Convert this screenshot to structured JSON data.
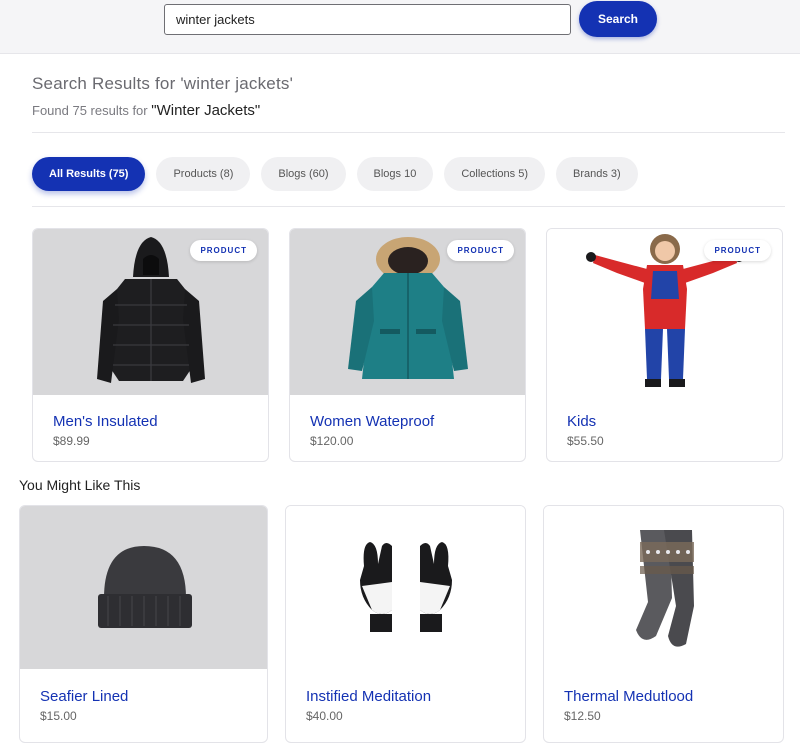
{
  "search": {
    "query": "winter jackets",
    "button_label": "Search"
  },
  "results": {
    "title": "Search Results for 'winter jackets'",
    "summary_prefix": "Found 75 results for",
    "summary_query": "\"Winter Jackets\""
  },
  "filters": [
    {
      "label": "All Results (75)",
      "active": true
    },
    {
      "label": "Products (8)",
      "active": false
    },
    {
      "label": "Blogs (60)",
      "active": false
    },
    {
      "label": "Blogs 10",
      "active": false
    },
    {
      "label": "Collections 5)",
      "active": false
    },
    {
      "label": "Brands 3)",
      "active": false
    }
  ],
  "products": [
    {
      "badge": "PRODUCT",
      "name": "Men's Insulated",
      "price": "$89.99",
      "icon": "black-puffer-jacket-icon"
    },
    {
      "badge": "PRODUCT",
      "name": "Women Wateproof",
      "price": "$120.00",
      "icon": "teal-parka-icon"
    },
    {
      "badge": "PRODUCT",
      "name": "Kids",
      "price": "$55.50",
      "icon": "kids-snowsuit-icon"
    }
  ],
  "recommendations": {
    "title": "You Might Like This",
    "items": [
      {
        "name": "Seafier Lined",
        "price": "$15.00",
        "icon": "beanie-hat-icon"
      },
      {
        "name": "Instified Meditation",
        "price": "$40.00",
        "icon": "winter-gloves-icon"
      },
      {
        "name": "Thermal Medutlood",
        "price": "$12.50",
        "icon": "wool-socks-icon"
      }
    ]
  },
  "colors": {
    "accent": "#1432b3",
    "chip_bg": "#f0f0f2",
    "image_bg": "#d7d7d9"
  }
}
